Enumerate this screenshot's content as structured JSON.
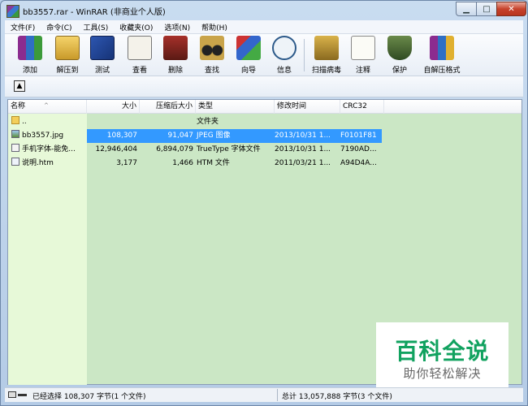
{
  "window": {
    "title": "bb3557.rar - WinRAR (非商业个人版)"
  },
  "menu": [
    "文件(F)",
    "命令(C)",
    "工具(S)",
    "收藏夹(O)",
    "选项(N)",
    "帮助(H)"
  ],
  "toolbar": {
    "add": "添加",
    "extract_to": "解压到",
    "test": "测试",
    "view": "查看",
    "delete": "删除",
    "find": "查找",
    "wizard": "向导",
    "info": "信息",
    "virus_scan": "扫描病毒",
    "comment": "注释",
    "protect": "保护",
    "sfx": "自解压格式"
  },
  "columns": {
    "name": "名称",
    "size": "大小",
    "packed": "压缩后大小",
    "type": "类型",
    "modified": "修改时间",
    "crc": "CRC32"
  },
  "rows": [
    {
      "name": "..",
      "size": "",
      "packed": "",
      "type": "文件夹",
      "modified": "",
      "crc": ""
    },
    {
      "name": "bb3557.jpg",
      "size": "108,307",
      "packed": "91,047",
      "type": "JPEG 图像",
      "modified": "2013/10/31 1...",
      "crc": "F0101F81"
    },
    {
      "name": "手机字体-能免...",
      "size": "12,946,404",
      "packed": "6,894,079",
      "type": "TrueType 字体文件",
      "modified": "2013/10/31 1...",
      "crc": "7190AD..."
    },
    {
      "name": "说明.htm",
      "size": "3,177",
      "packed": "1,466",
      "type": "HTM 文件",
      "modified": "2011/03/21 1...",
      "crc": "A94D4A..."
    }
  ],
  "status": {
    "left": "已经选择 108,307 字节(1 个文件)",
    "right": "总计 13,057,888 字节(3 个文件)"
  },
  "watermark": {
    "title": "百科全说",
    "subtitle": "助你轻松解决"
  }
}
